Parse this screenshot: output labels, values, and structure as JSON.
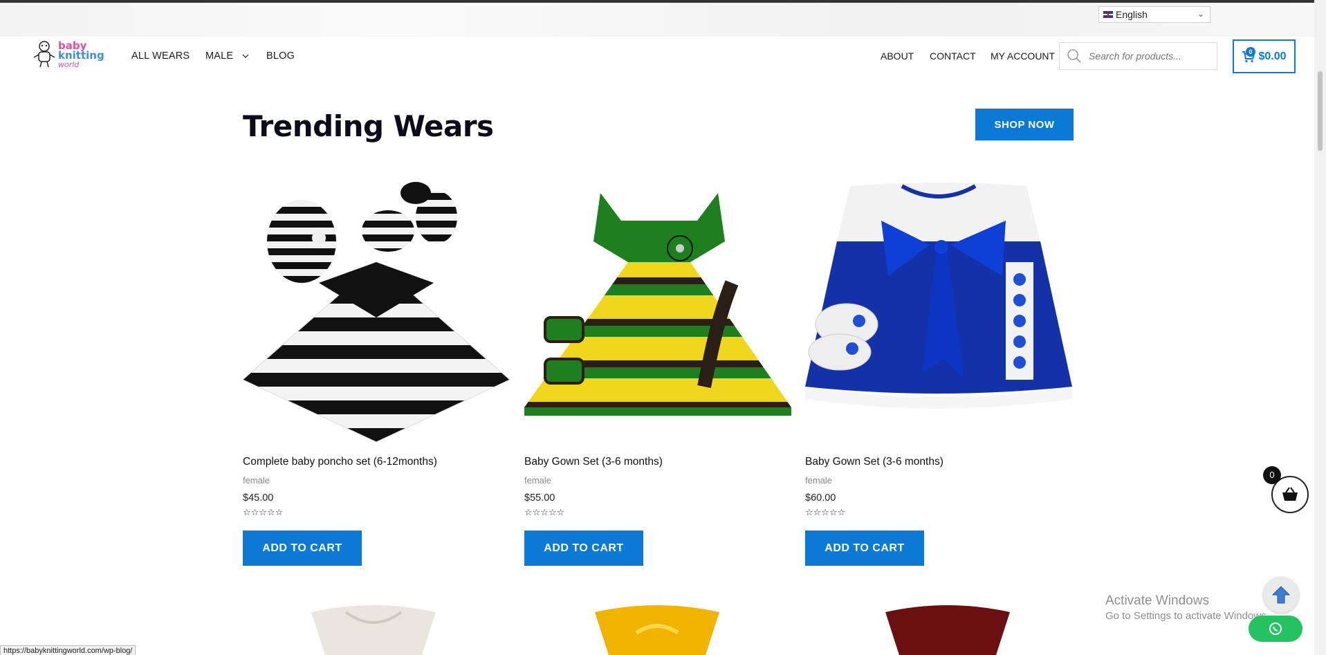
{
  "language": {
    "selected": "English"
  },
  "logo": {
    "line1": "baby",
    "line2": "knitting",
    "line3": "world"
  },
  "nav": {
    "left": [
      "ALL WEARS",
      "MALE",
      "BLOG"
    ],
    "right": [
      "ABOUT",
      "CONTACT",
      "MY ACCOUNT"
    ]
  },
  "search": {
    "placeholder": "Search for products..."
  },
  "cart": {
    "count": "0",
    "total": "$0.00"
  },
  "section": {
    "title": "Trending Wears",
    "shop_now": "SHOP NOW"
  },
  "products": [
    {
      "name": "Complete baby poncho set (6-12months)",
      "category": "female",
      "price": "$45.00",
      "rating": 0,
      "add_to_cart": "ADD TO CART"
    },
    {
      "name": "Baby Gown Set (3-6 months)",
      "category": "female",
      "price": "$55.00",
      "rating": 0,
      "add_to_cart": "ADD TO CART"
    },
    {
      "name": "Baby Gown Set (3-6 months)",
      "category": "female",
      "price": "$60.00",
      "rating": 0,
      "add_to_cart": "ADD TO CART"
    }
  ],
  "floating_cart": {
    "count": "0"
  },
  "watermark": {
    "line1": "Activate Windows",
    "line2": "Go to Settings to activate Windows."
  },
  "status_bar": {
    "url": "https://babyknittingworld.com/wp-blog/"
  },
  "colors": {
    "accent": "#0a7ad6",
    "whatsapp": "#25c35f",
    "logo_pink": "#e84d9b",
    "logo_blue": "#3b8fd8"
  }
}
